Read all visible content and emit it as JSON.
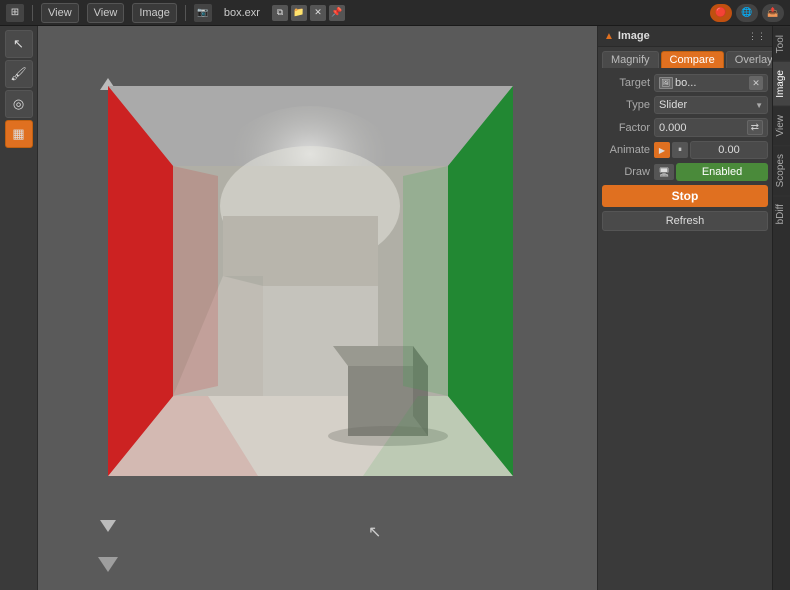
{
  "top_bar": {
    "icon_label": "⊞",
    "view_btn1": "View",
    "view_btn2": "View",
    "image_btn": "Image",
    "filename": "box.exr",
    "pin_icon": "📌"
  },
  "left_toolbar": {
    "tools": [
      {
        "name": "cursor-tool",
        "icon": "↖",
        "active": false
      },
      {
        "name": "paint-tool",
        "icon": "🖌",
        "active": false
      },
      {
        "name": "sample-tool",
        "icon": "◎",
        "active": false
      },
      {
        "name": "checker-tool",
        "icon": "▦",
        "active": true
      }
    ]
  },
  "image_panel": {
    "title": "Image",
    "triangle_icon": "▲",
    "menu_icon": "⋮⋮",
    "tabs": [
      {
        "label": "Magnify",
        "active": false
      },
      {
        "label": "Compare",
        "active": true
      },
      {
        "label": "Overlay",
        "active": false
      }
    ],
    "fields": {
      "target_label": "Target",
      "target_value": "bo...",
      "type_label": "Type",
      "type_value": "Slider",
      "factor_label": "Factor",
      "factor_value": "0.000",
      "animate_label": "Animate",
      "animate_number": "0.00",
      "draw_label": "Draw",
      "draw_value": "Enabled"
    },
    "stop_label": "Stop",
    "refresh_label": "Refresh"
  },
  "side_tabs": [
    {
      "label": "Tool",
      "active": false
    },
    {
      "label": "Image",
      "active": true
    },
    {
      "label": "View",
      "active": false
    },
    {
      "label": "Scopes",
      "active": false
    },
    {
      "label": "bDiff",
      "active": false
    }
  ]
}
